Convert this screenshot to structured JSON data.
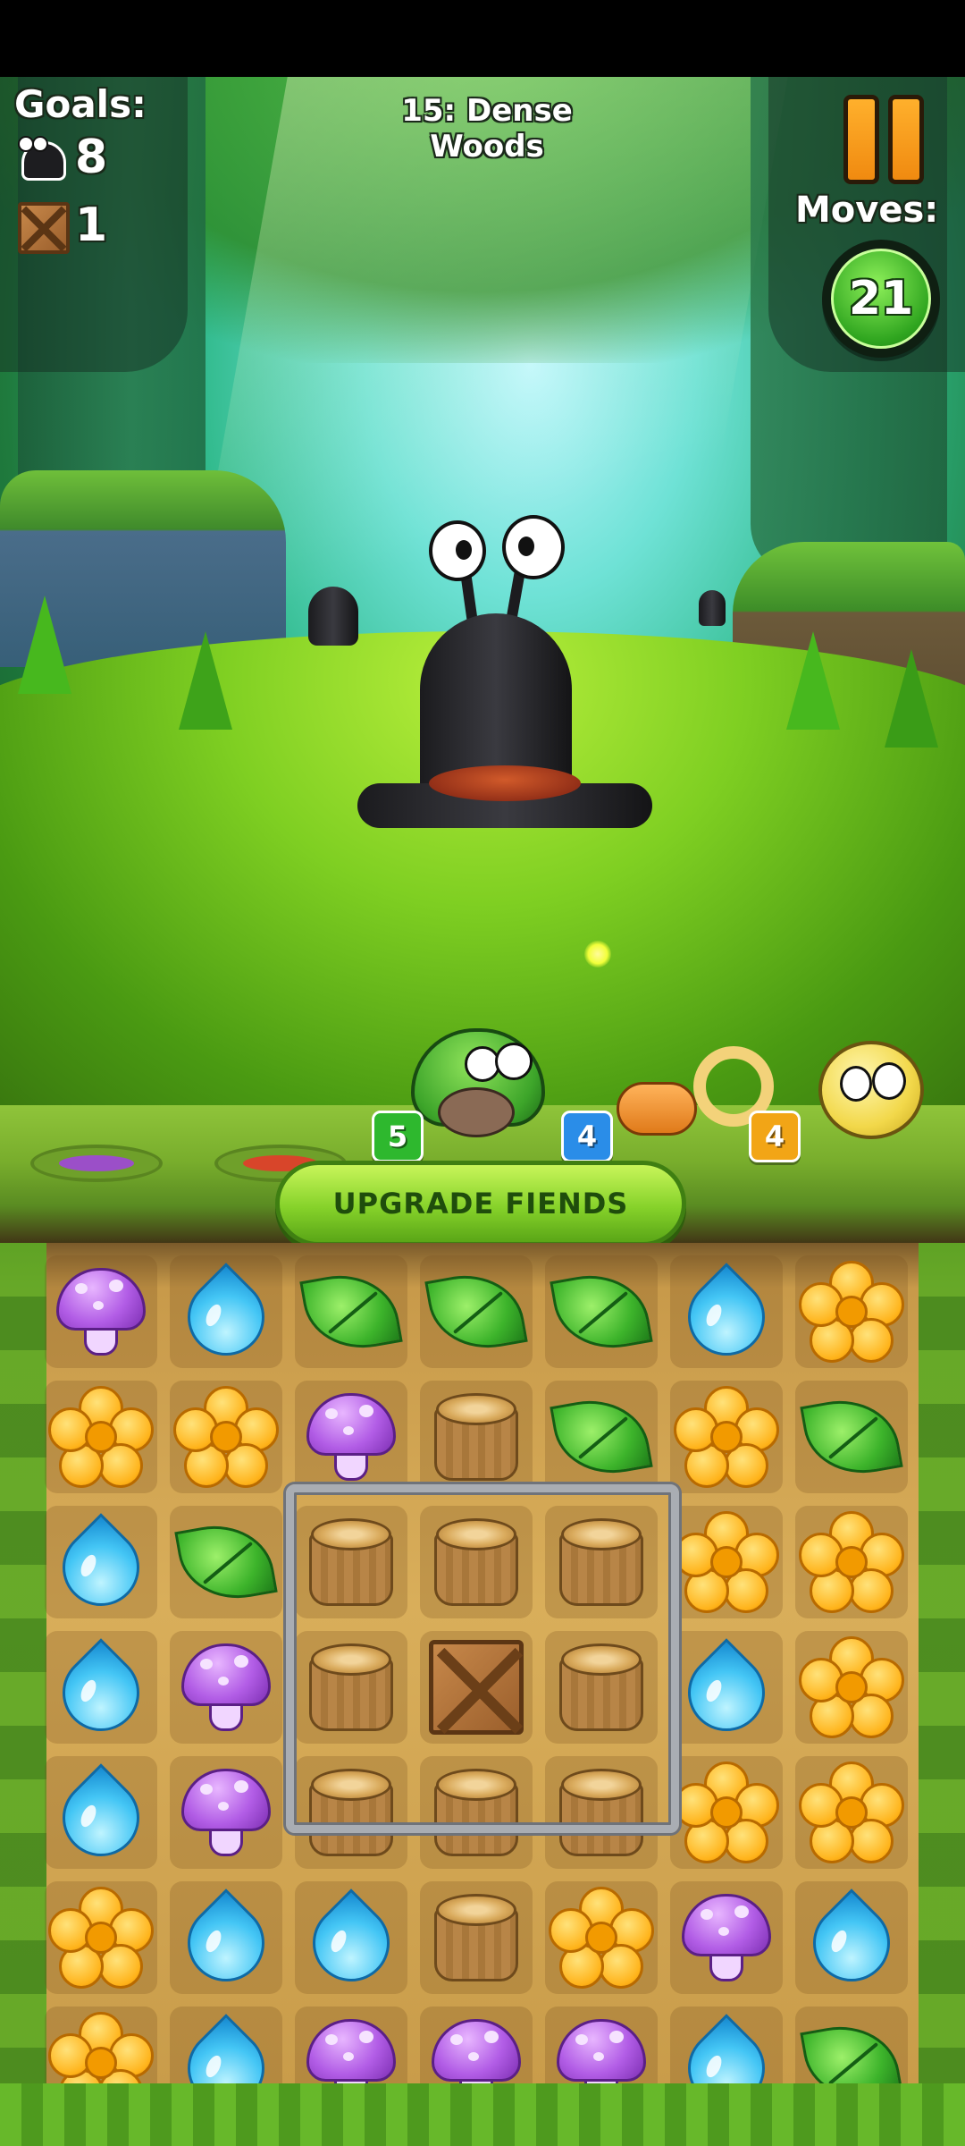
{
  "level": {
    "title": "15: Dense Woods"
  },
  "goals": {
    "label": "Goals:",
    "items": [
      {
        "icon": "slug-goal-icon",
        "count": "8"
      },
      {
        "icon": "crate-goal-icon",
        "count": "1"
      }
    ]
  },
  "moves": {
    "label": "Moves:",
    "value": "21"
  },
  "pause": {
    "icon": "pause-icon"
  },
  "fiends": [
    {
      "name": "green-beetle-fiend",
      "level": "5",
      "badge_color": "#2eb82e"
    },
    {
      "name": "blue-pad",
      "level": "4",
      "badge_color": "#2a8de8"
    },
    {
      "name": "orange-snail-fiend",
      "level": "4",
      "badge_color": "#f2a516"
    }
  ],
  "upgrade_button": {
    "label": "UPGRADE FIENDS"
  },
  "board": {
    "cols": 7,
    "rows": 7,
    "grid": [
      [
        "mushroom",
        "drop",
        "leaf",
        "leaf",
        "leaf",
        "drop",
        "flower"
      ],
      [
        "flower",
        "flower",
        "mushroom",
        "stump",
        "leaf",
        "flower",
        "leaf"
      ],
      [
        "drop",
        "leaf",
        "stump",
        "stump",
        "stump",
        "flower",
        "flower"
      ],
      [
        "drop",
        "mushroom",
        "stump",
        "crate",
        "stump",
        "drop",
        "flower"
      ],
      [
        "drop",
        "mushroom",
        "stump",
        "stump",
        "stump",
        "flower",
        "flower"
      ],
      [
        "flower",
        "drop",
        "drop",
        "stump",
        "flower",
        "mushroom",
        "drop"
      ],
      [
        "flower",
        "drop",
        "mushroom",
        "mushroom",
        "mushroom",
        "drop",
        "leaf"
      ]
    ]
  },
  "colors": {
    "accent_green": "#86d22a",
    "board_sand": "#d9ae5a",
    "moves_green": "#2fa51f"
  }
}
